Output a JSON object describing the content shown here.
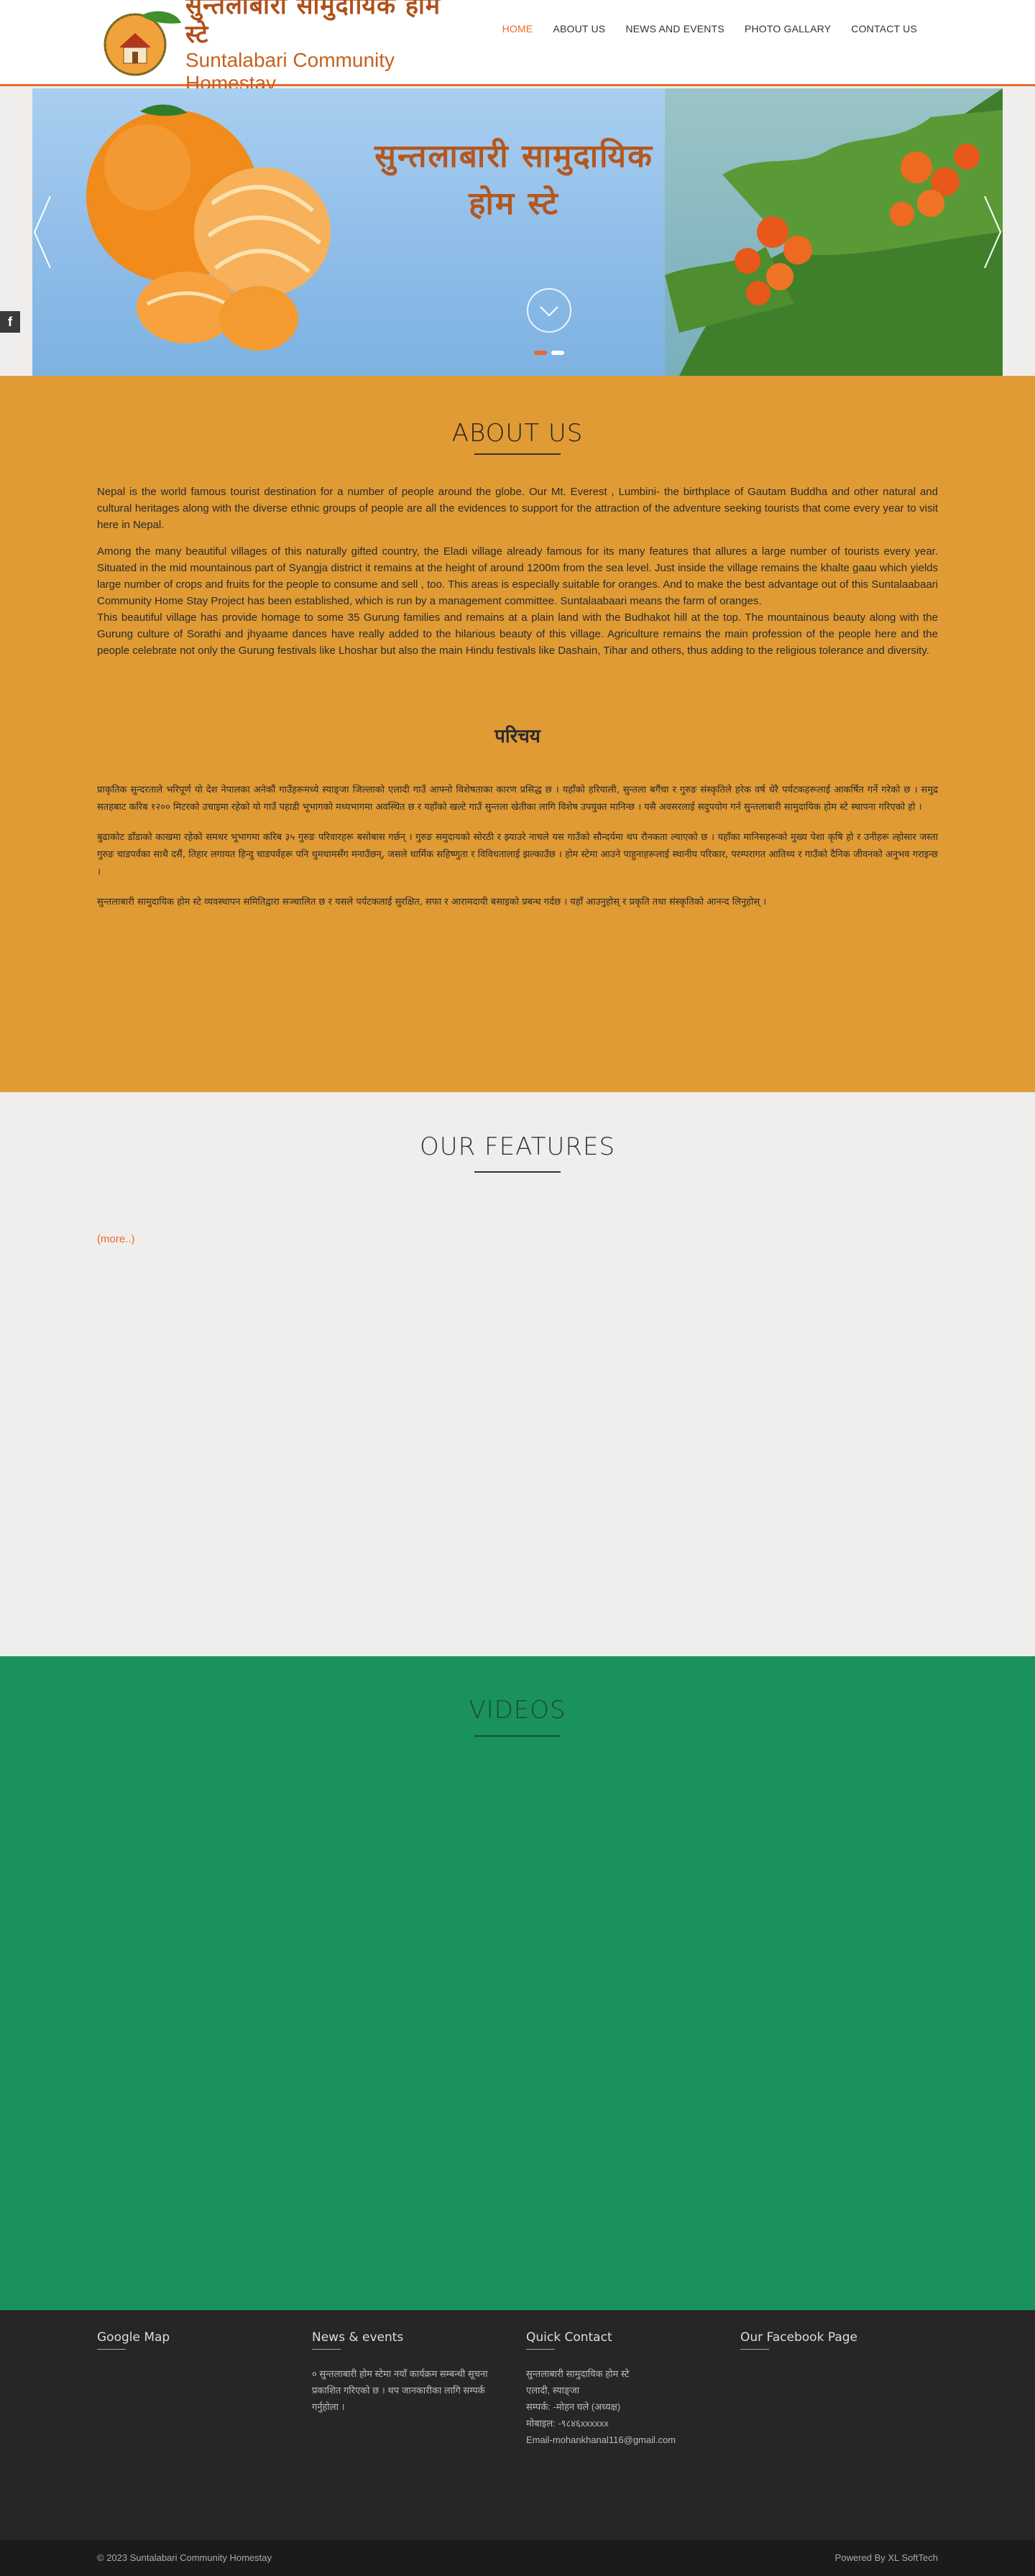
{
  "header": {
    "logo_np": "सुन्तलाबारी सामुदायिक होम स्टे",
    "logo_en": "Suntalabari Community Homestay",
    "nav": [
      {
        "label": "HOME"
      },
      {
        "label": "ABOUT US"
      },
      {
        "label": "NEWS AND EVENTS"
      },
      {
        "label": "PHOTO GALLARY"
      },
      {
        "label": "CONTACT US"
      }
    ],
    "active_color": "#e86a2c"
  },
  "hero": {
    "title_line1": "सुन्तलाबारी सामुदायिक",
    "title_line2": "होम स्टे",
    "slide_count": 2,
    "active_slide": 1
  },
  "social": {
    "facebook_icon": "f"
  },
  "about": {
    "title": "ABOUT US",
    "p1": "Nepal is the world famous tourist destination for a number of people around the globe. Our Mt. Everest , Lumbini- the birthplace of Gautam Buddha and other natural and cultural heritages along with the diverse ethnic groups of people are all the evidences to support for the attraction of the adventure seeking tourists that come every year to visit here in Nepal.",
    "p2": "Among the many beautiful villages of this naturally gifted country, the Eladi village already famous for its many features that allures a large number of tourists every year. Situated in the mid mountainous part of Syangja district it remains at the height of around 1200m from the sea level. Just inside the village remains the khalte gaau which yields large number of crops and fruits for the people to consume and sell , too. This areas is especially suitable for oranges. And to make the best advantage out of this Suntalaabaari Community Home Stay Project has been established, which is run by a management committee. Suntalaabaari means the farm of oranges.",
    "p3": "This beautiful village has provide homage to some 35 Gurung families and remains at a plain land with the Budhakot hill at the top. The mountainous beauty along with the Gurung culture of Sorathi and jhyaame dances have really added to the hilarious beauty of this village. Agriculture remains the main profession of the people here and the people celebrate not only the Gurung festivals like Lhoshar but also the main Hindu festivals like Dashain, Tihar and others, thus adding to the religious tolerance and diversity.",
    "np_heading": "परिचय",
    "np_p1": "प्राकृतिक सुन्दरताले भरिपूर्ण यो देश नेपालका अनेकौं गाउँहरूमध्ये स्याङ्जा जिल्लाको एलादी गाउँ आफ्नो विशेषताका कारण प्रसिद्ध छ । यहाँको हरियाली, सुन्तला बगैंचा र गुरुङ संस्कृतिले हरेक वर्ष धेरै पर्यटकहरूलाई आकर्षित गर्ने गरेको छ । समुद्र सतहबाट करिब १२०० मिटरको उचाइमा रहेको यो गाउँ पहाडी भूभागको मध्यभागमा अवस्थित छ र यहाँको खल्टे गाउँ सुन्तला खेतीका लागि विशेष उपयुक्त मानिन्छ । यसै अवसरलाई सदुपयोग गर्न सुन्तलाबारी सामुदायिक होम स्टे स्थापना गरिएको हो ।",
    "np_p2": "बुढाकोट डाँडाको काखमा रहेको समथर भूभागमा करिब ३५ गुरुङ परिवारहरू बसोबास गर्छन् । गुरुङ समुदायको सोरठी र झ्याउरे नाचले यस गाउँको सौन्दर्यमा थप रौनकता ल्याएको छ । यहाँका मानिसहरूको मुख्य पेशा कृषि हो र उनीहरू ल्होसार जस्ता गुरुङ चाडपर्वका साथै दसैं, तिहार लगायत हिन्दु चाडपर्वहरू पनि धुमधामसँग मनाउँछन्, जसले धार्मिक सहिष्णुता र विविधतालाई झल्काउँछ । होम स्टेमा आउने पाहुनाहरूलाई स्थानीय परिकार, परम्परागत आतिथ्य र गाउँको दैनिक जीवनको अनुभव गराइन्छ ।",
    "np_p3": "सुन्तलाबारी सामुदायिक होम स्टे व्यवस्थापन समितिद्वारा सञ्चालित छ र यसले पर्यटकलाई सुरक्षित, सफा र आरामदायी बसाइको प्रबन्ध गर्दछ । यहाँ आउनुहोस् र प्रकृति तथा संस्कृतिको आनन्द लिनुहोस् ।"
  },
  "features": {
    "title": "OUR FEATURES",
    "more": "(more..)"
  },
  "videos": {
    "title": "VIDEOS"
  },
  "footer": {
    "col1": {
      "title": "Google Map"
    },
    "col2": {
      "title": "News & events",
      "text": "० सुन्तलाबारी होम स्टेमा नयाँ कार्यक्रम सम्बन्धी सूचना प्रकाशित गरिएको छ । थप जानकारीका लागि सम्पर्क गर्नुहोला ।"
    },
    "col3": {
      "title": "Quick Contact",
      "line1": "सुन्तलाबारी सामुदायिक होम स्टे",
      "line2": "एलादी, स्याङ्जा",
      "line3": "सम्पर्क: -मोहन घले (अध्यक्ष)",
      "line4": "मोबाइल: -९८४६xxxxxx",
      "email": "Email-mohankhanal116@gmail.com"
    },
    "col4": {
      "title": "Our Facebook Page"
    }
  },
  "bottom": {
    "copyright": "© 2023 Suntalabari Community Homestay",
    "powered": "Powered By XL SoftTech"
  }
}
